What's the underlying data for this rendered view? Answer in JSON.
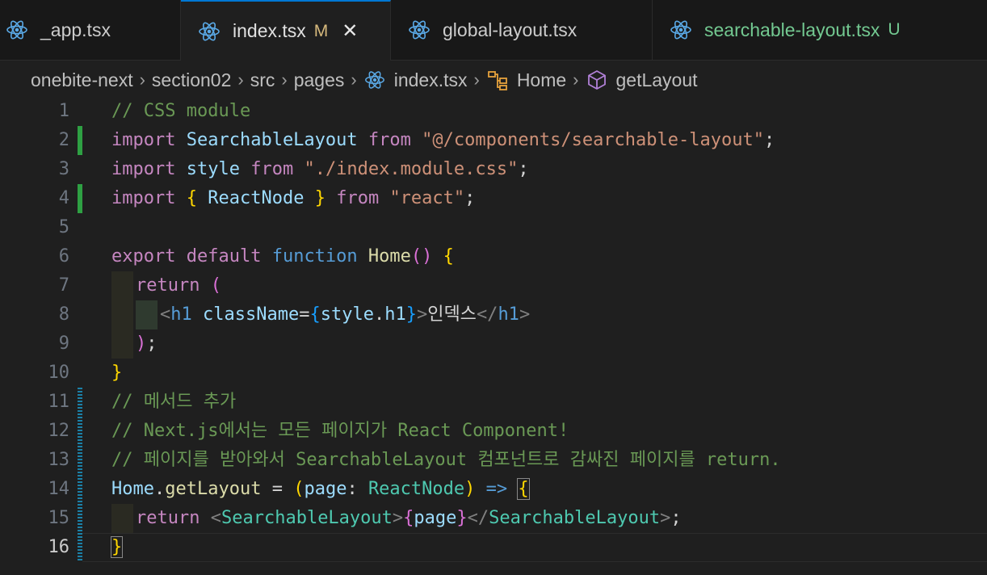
{
  "tabs": [
    {
      "label": "_app.tsx",
      "badge": "",
      "active": false
    },
    {
      "label": "index.tsx",
      "badge": "M",
      "active": true,
      "close": "✕"
    },
    {
      "label": "global-layout.tsx",
      "badge": "",
      "active": false
    },
    {
      "label": "searchable-layout.tsx",
      "badge": "U",
      "active": false
    }
  ],
  "breadcrumb": {
    "parts": [
      "onebite-next",
      "section02",
      "src",
      "pages"
    ],
    "file": "index.tsx",
    "symbol1": "Home",
    "symbol2": "getLayout",
    "separator": "›"
  },
  "colors": {
    "react_icon": "#5aa9e6",
    "modified_badge": "#d7ba7d",
    "untracked": "#73c991",
    "accent": "#0078d4",
    "symbol_class": "#e6a23c",
    "symbol_method": "#b180d7"
  },
  "editor": {
    "line_numbers": [
      "1",
      "2",
      "3",
      "4",
      "5",
      "6",
      "7",
      "8",
      "9",
      "10",
      "11",
      "12",
      "13",
      "14",
      "15",
      "16"
    ],
    "lines": {
      "l1": {
        "c": "// CSS module"
      },
      "l2": {
        "a": "import",
        "b": "SearchableLayout",
        "c": "from",
        "d": "\"@/components/searchable-layout\"",
        "e": ";"
      },
      "l3": {
        "a": "import",
        "b": "style",
        "c": "from",
        "d": "\"./index.module.css\"",
        "e": ";"
      },
      "l4": {
        "a": "import",
        "b": "{",
        "c": "ReactNode",
        "d": "}",
        "e": "from",
        "f": "\"react\"",
        "g": ";"
      },
      "l6": {
        "a": "export",
        "b": "default",
        "c": "function",
        "d": "Home",
        "e": "()",
        "f": "{"
      },
      "l7": {
        "a": "return",
        "b": "("
      },
      "l8": {
        "a": "<",
        "b": "h1",
        "c": "className",
        "d": "=",
        "e": "{",
        "f": "style",
        "g": ".",
        "h": "h1",
        "i": "}",
        "j": ">",
        "k": "인덱스",
        "l": "</",
        "m": "h1",
        "n": ">"
      },
      "l9": {
        "a": ")",
        "b": ";"
      },
      "l10": {
        "a": "}"
      },
      "l11": {
        "c": "// 메서드 추가"
      },
      "l12": {
        "c": "// Next.js에서는 모든 페이지가 React Component!"
      },
      "l13": {
        "c": "// 페이지를 받아와서 SearchableLayout 컴포넌트로 감싸진 페이지를 return."
      },
      "l14": {
        "a": "Home",
        "b": ".",
        "c": "getLayout",
        "d": "=",
        "e": "(",
        "f": "page",
        "g": ":",
        "h": "ReactNode",
        "i": ")",
        "j": "=>",
        "k": "{"
      },
      "l15": {
        "a": "return",
        "b": "<",
        "c": "SearchableLayout",
        "d": ">",
        "e": "{",
        "f": "page",
        "g": "}",
        "h": "</",
        "i": "SearchableLayout",
        "j": ">",
        "k": ";"
      },
      "l16": {
        "a": "}"
      }
    }
  }
}
